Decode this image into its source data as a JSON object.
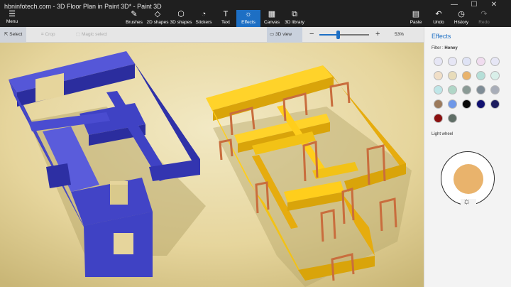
{
  "window": {
    "title": "hbninfotech.com - 3D Floor Plan in Paint 3D* - Paint 3D",
    "controls": {
      "minimize": "—",
      "maximize": "☐",
      "close": "✕"
    }
  },
  "menu": {
    "label": "Menu",
    "icon": "hamburger-icon",
    "glyph": "☰"
  },
  "tools": [
    {
      "label": "Brushes",
      "icon": "brush-icon",
      "glyph": "✎"
    },
    {
      "label": "2D shapes",
      "icon": "shapes-2d-icon",
      "glyph": "◇"
    },
    {
      "label": "3D shapes",
      "icon": "cube-icon",
      "glyph": "⬡"
    },
    {
      "label": "Stickers",
      "icon": "sticker-icon",
      "glyph": "◔"
    },
    {
      "label": "Text",
      "icon": "text-icon",
      "glyph": "T"
    },
    {
      "label": "Effects",
      "icon": "sun-icon",
      "glyph": "☼"
    },
    {
      "label": "Canvas",
      "icon": "canvas-icon",
      "glyph": "▦"
    },
    {
      "label": "3D library",
      "icon": "library-icon",
      "glyph": "⧉"
    }
  ],
  "right_tools": [
    {
      "label": "Paste",
      "icon": "paste-icon",
      "glyph": "▤"
    },
    {
      "label": "Undo",
      "icon": "undo-icon",
      "glyph": "↶"
    },
    {
      "label": "History",
      "icon": "history-icon",
      "glyph": "◷"
    },
    {
      "label": "Redo",
      "icon": "redo-icon",
      "glyph": "↷"
    }
  ],
  "subbar": {
    "select": "Select",
    "crop": "Crop",
    "magic_select": "Magic select",
    "view3d": "3D view",
    "zoom_pct": "53%",
    "zoom_value": 0.37
  },
  "effects": {
    "title": "Effects",
    "filter_label": "Filter :",
    "filter_value": "Honey",
    "light_wheel_label": "Light wheel",
    "swatches": [
      "#e6e6f5",
      "#e6e6f5",
      "#dfe3f5",
      "#f0dcef",
      "#e6e6f5",
      "#f1dfc7",
      "#e8dcba",
      "#e9b36c",
      "#b5dfd8",
      "#d9efe9",
      "#bfe6e8",
      "#b0d6c7",
      "#8a9a95",
      "#7f8c96",
      "#a8adb8",
      "#9c7a5c",
      "#6f98e8",
      "#0a0a0a",
      "#101070",
      "#1d1d5e",
      "#8a1010",
      "#5f6e66"
    ],
    "light_color": "#e9b36c"
  },
  "colors": {
    "accent": "#1d6fc4",
    "wall_blue": "#3f42c4",
    "wall_yellow": "#f2c216",
    "door_frame": "#c96d3d"
  }
}
